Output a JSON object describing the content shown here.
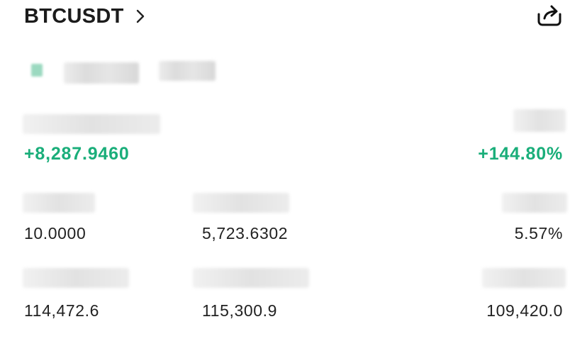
{
  "header": {
    "symbol": "BTCUSDT",
    "chevron_icon": "chevron-right-icon",
    "share_icon": "share-icon"
  },
  "pnl": {
    "amount": "+8,287.9460",
    "percent": "+144.80%",
    "positive_color": "#1aae7a"
  },
  "stats": {
    "row1": [
      "10.0000",
      "5,723.6302",
      "5.57%"
    ],
    "row2": [
      "114,472.6",
      "115,300.9",
      "109,420.0"
    ]
  }
}
